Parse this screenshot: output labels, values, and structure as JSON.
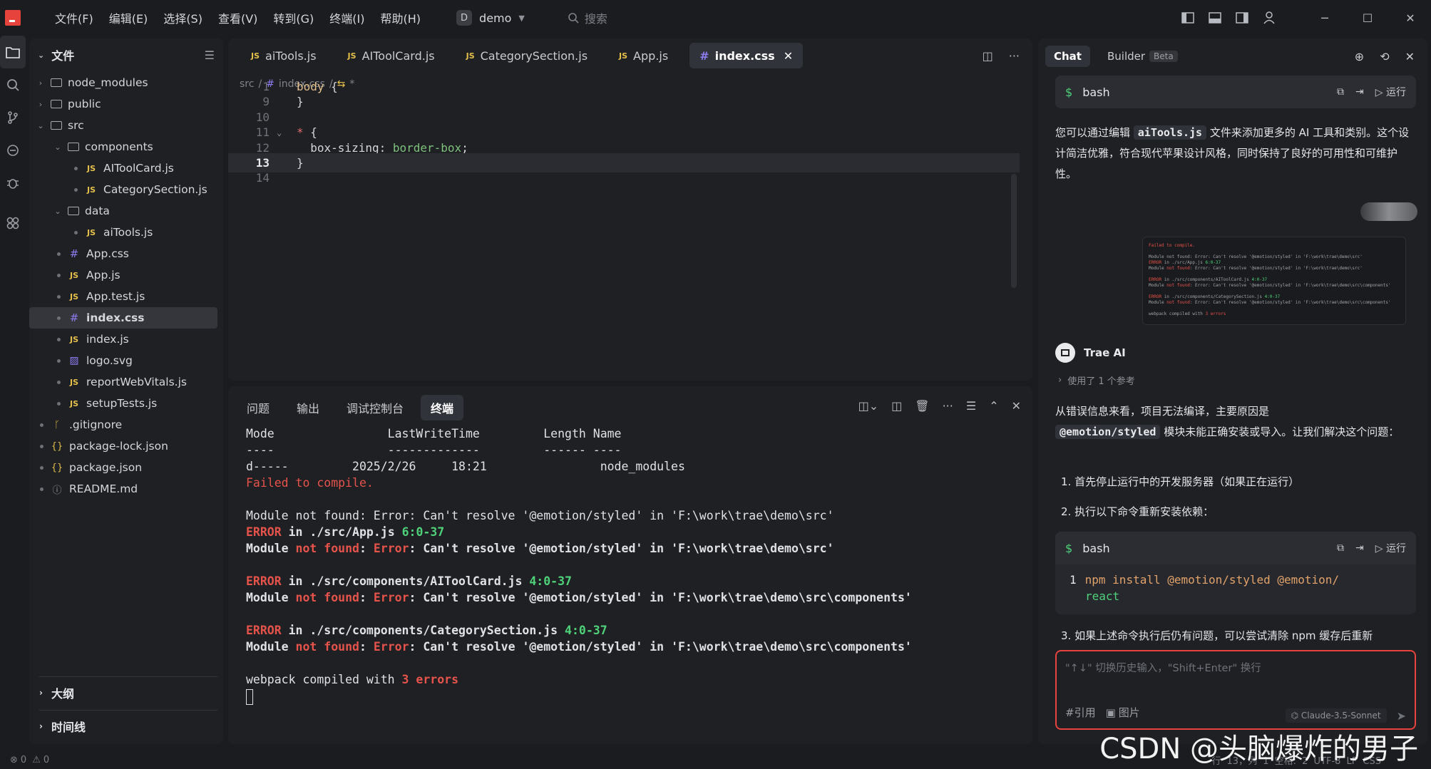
{
  "menu": [
    "文件(F)",
    "编辑(E)",
    "选择(S)",
    "查看(V)",
    "转到(G)",
    "终端(I)",
    "帮助(H)"
  ],
  "project": {
    "badge": "D",
    "name": "demo"
  },
  "search": {
    "placeholder": "搜索"
  },
  "sidebar": {
    "title": "文件",
    "tree": [
      {
        "label": "node_modules",
        "kind": "folder",
        "depth": 0,
        "open": false
      },
      {
        "label": "public",
        "kind": "folder",
        "depth": 0,
        "open": false
      },
      {
        "label": "src",
        "kind": "folder",
        "depth": 0,
        "open": true
      },
      {
        "label": "components",
        "kind": "folder",
        "depth": 1,
        "open": true
      },
      {
        "label": "AIToolCard.js",
        "kind": "js",
        "depth": 2
      },
      {
        "label": "CategorySection.js",
        "kind": "js",
        "depth": 2
      },
      {
        "label": "data",
        "kind": "folder",
        "depth": 1,
        "open": true
      },
      {
        "label": "aiTools.js",
        "kind": "js",
        "depth": 2
      },
      {
        "label": "App.css",
        "kind": "css",
        "depth": 1
      },
      {
        "label": "App.js",
        "kind": "js",
        "depth": 1
      },
      {
        "label": "App.test.js",
        "kind": "js",
        "depth": 1
      },
      {
        "label": "index.css",
        "kind": "css",
        "depth": 1,
        "selected": true
      },
      {
        "label": "index.js",
        "kind": "js",
        "depth": 1
      },
      {
        "label": "logo.svg",
        "kind": "img",
        "depth": 1
      },
      {
        "label": "reportWebVitals.js",
        "kind": "js",
        "depth": 1
      },
      {
        "label": "setupTests.js",
        "kind": "js",
        "depth": 1
      },
      {
        "label": ".gitignore",
        "kind": "git",
        "depth": 0
      },
      {
        "label": "package-lock.json",
        "kind": "json",
        "depth": 0
      },
      {
        "label": "package.json",
        "kind": "json",
        "depth": 0
      },
      {
        "label": "README.md",
        "kind": "info",
        "depth": 0
      }
    ],
    "outline": "大纲",
    "timeline": "时间线"
  },
  "editor": {
    "tabs": [
      {
        "label": "aiTools.js",
        "kind": "js"
      },
      {
        "label": "AIToolCard.js",
        "kind": "js"
      },
      {
        "label": "CategorySection.js",
        "kind": "js"
      },
      {
        "label": "App.js",
        "kind": "js"
      },
      {
        "label": "index.css",
        "kind": "css",
        "active": true
      }
    ],
    "breadcrumb": [
      "src",
      "#",
      "index.css",
      "*"
    ],
    "lines": [
      {
        "n": "1",
        "code": "body {"
      },
      {
        "n": "9",
        "code": "}"
      },
      {
        "n": "10",
        "code": ""
      },
      {
        "n": "11",
        "code": "* {"
      },
      {
        "n": "12",
        "code": "  box-sizing: border-box;"
      },
      {
        "n": "13",
        "code": "}"
      },
      {
        "n": "14",
        "code": ""
      }
    ]
  },
  "panel": {
    "tabs": [
      "问题",
      "输出",
      "调试控制台",
      "终端"
    ],
    "active_tab": "终端",
    "terminal": {
      "header": "Mode                LastWriteTime         Length Name",
      "sep": "----                -------------         ------ ----",
      "dir": "d-----         2025/2/26     18:21                node_modules",
      "failed": "Failed to compile.",
      "err1": "Module not found: Error: Can't resolve '@emotion/styled' in 'F:\\work\\trae\\demo\\src'",
      "loc1_file": "./src/App.js",
      "loc1_pos": "6:0-37",
      "msg_path1": "'F:\\work\\trae\\demo\\src'",
      "loc2_file": "./src/components/AIToolCard.js",
      "loc2_pos": "4:0-37",
      "msg_path2": "'F:\\work\\trae\\demo\\src\\components'",
      "loc3_file": "./src/components/CategorySection.js",
      "loc3_pos": "4:0-37",
      "msg_path3": "'F:\\work\\trae\\demo\\src\\components'",
      "compiled_prefix": "webpack compiled with ",
      "compiled_errors": "3 errors"
    }
  },
  "chat": {
    "tabs": {
      "chat": "Chat",
      "builder": "Builder",
      "beta": "Beta"
    },
    "block1": {
      "lang": "bash",
      "run": "运行"
    },
    "intro": "您可以通过编辑 aiTools.js 文件来添加更多的 AI 工具和类别。这个设计简洁优雅，符合现代苹果设计风格，同时保持了良好的可用性和可维护性。",
    "intro_pre": "您可以通过编辑 ",
    "intro_code": "aiTools.js",
    "intro_post": " 文件来添加更多的 AI 工具和类别。这个设计简洁优雅，符合现代苹果设计风格，同时保持了良好的可用性和可维护性。",
    "assistant": "Trae AI",
    "refs": "使用了 1 个参考",
    "answer_pre": "从错误信息来看，项目无法编译，主要原因是",
    "answer_code": "@emotion/styled",
    "answer_post": " 模块未能正确安装或导入。让我们解决这个问题：",
    "step1": "1. 首先停止运行中的开发服务器（如果正在运行）",
    "step2": "2. 执行以下命令重新安装依赖：",
    "block2": {
      "lang": "bash",
      "run": "运行",
      "line_no": "1",
      "cmd1": "npm install @emotion/styled @emotion/",
      "cmd2": "react"
    },
    "step3": "3. 如果上述命令执行后仍有问题，可以尝试清除 npm 缓存后重新",
    "input_placeholder": "\"↑↓\" 切换历史输入，\"Shift+Enter\" 换行",
    "ref_btn": "#引用",
    "img_btn": "图片",
    "model": "Claude-3.5-Sonnet"
  },
  "status": {
    "errors": "0",
    "warnings": "0",
    "right": "行 13，列 1   空格: 2   UTF-8   LF   CSS"
  },
  "watermark": "CSDN @头脑爆炸的男子"
}
